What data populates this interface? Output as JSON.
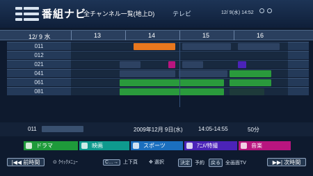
{
  "header": {
    "title": "番組ナビ",
    "subtitle": "全チャンネル一覧(地上D)",
    "channel_type": "テレビ",
    "datetime": "12/ 9(水) 14:52"
  },
  "timebar": {
    "date": "12/ 9  水",
    "hours": [
      "13",
      "14",
      "15",
      "16"
    ]
  },
  "channels": [
    "011",
    "012",
    "021",
    "041",
    "061",
    "081"
  ],
  "info": {
    "channel": "011",
    "date": "2009年12月 9日(水)",
    "time": "14:05-14:55",
    "duration": "50分"
  },
  "genres": [
    {
      "label": "ドラマ",
      "color": "#1e9a3a"
    },
    {
      "label": "映画",
      "color": "#0e9a8e"
    },
    {
      "label": "スポーツ",
      "color": "#1b6fbf"
    },
    {
      "label": "ｱﾆﾒ/特撮",
      "color": "#4b23b8"
    },
    {
      "label": "音楽",
      "color": "#b8157f"
    }
  ],
  "footer": {
    "prev_time": "|◀◀ 前時間",
    "quick_menu": "ｸｲｯｸﾒﾆｭｰ",
    "page_label": "上下頁",
    "select_label": "選択",
    "reserve_key": "決定",
    "reserve_label": "予約",
    "back_key": "戻る",
    "fullscreen_label": "全画面TV",
    "next_time": "▶▶| 次時間"
  },
  "colors": {
    "highlight": "#e8771e",
    "drama": "#2a9a3c",
    "movie_dark": "#1e3a3a",
    "music": "#b8157f",
    "anime": "#4b23b8"
  }
}
